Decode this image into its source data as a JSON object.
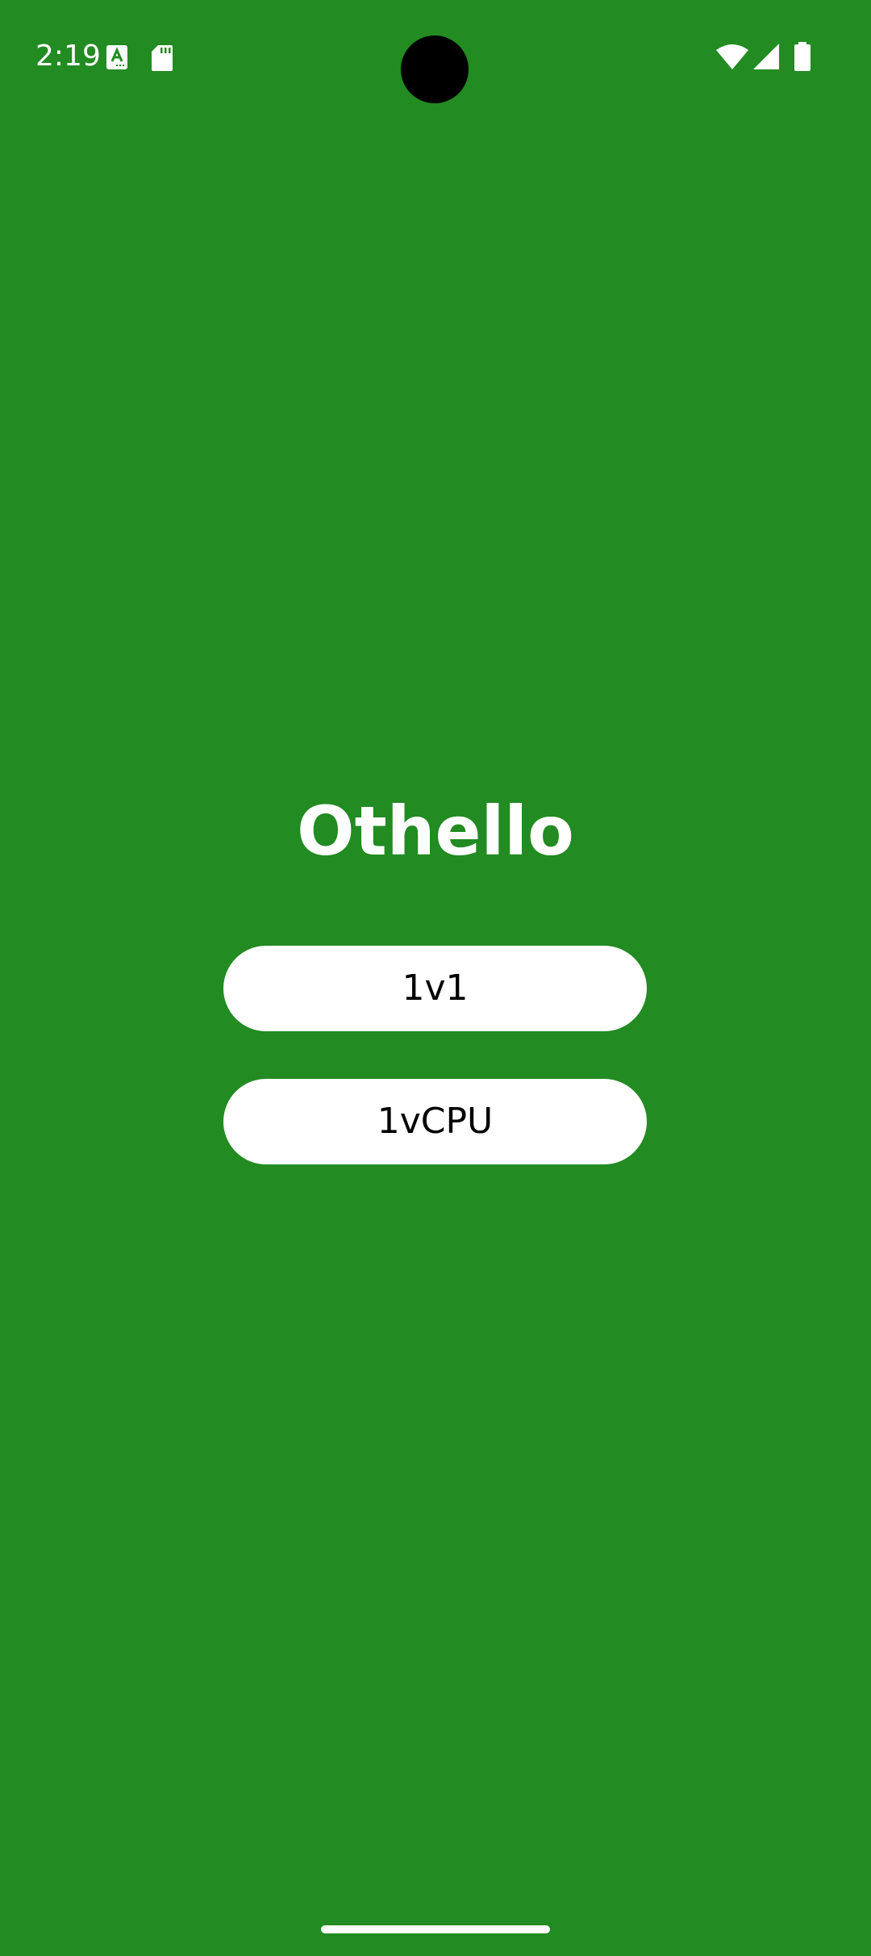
{
  "status_bar": {
    "time": "2:19",
    "left_icons": [
      "keyboard-a-icon",
      "sd-card-icon"
    ],
    "right_icons": [
      "wifi-icon",
      "cellular-signal-icon",
      "battery-icon"
    ]
  },
  "app": {
    "title": "Othello",
    "background_color": "#228B22"
  },
  "menu": {
    "buttons": [
      {
        "label": "1v1"
      },
      {
        "label": "1vCPU"
      }
    ]
  }
}
